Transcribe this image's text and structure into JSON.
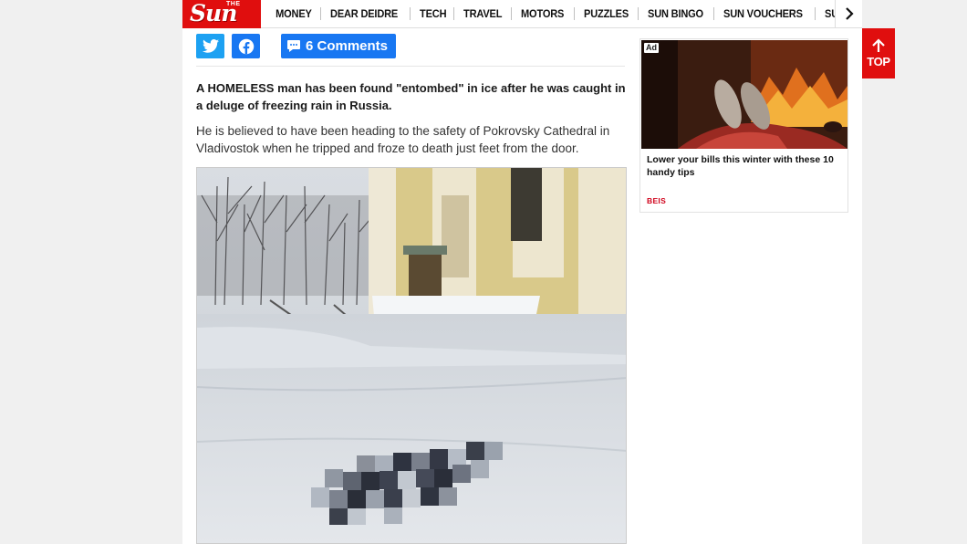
{
  "header": {
    "logo_small": "THE",
    "logo_main": "Sun",
    "nav_items": [
      "MONEY",
      "DEAR DEIDRE",
      "TECH",
      "TRAVEL",
      "MOTORS",
      "PUZZLES",
      "SUN BINGO",
      "SUN VOUCHERS",
      "SUN WIN"
    ]
  },
  "share": {
    "comments_label": "6 Comments"
  },
  "article": {
    "lead": "A HOMELESS man has been found \"entombed\" in ice after he was caught in a deluge of freezing rain in Russia.",
    "paragraph": "He is believed to have been heading to the safety of Pokrovsky Cathedral in Vladivostok when he tripped and froze to death just feet from the door."
  },
  "ad": {
    "badge": "Ad",
    "title": "Lower your bills this winter with these 10 handy tips",
    "source": "BEIS"
  },
  "top_button": {
    "label": "TOP"
  },
  "colors": {
    "brand_red": "#e00e0e",
    "twitter_blue": "#1da1f2",
    "facebook_blue": "#1877f2",
    "ad_source_red": "#d0021b"
  },
  "icons": [
    "twitter-icon",
    "facebook-icon",
    "comment-icon",
    "chevron-right-icon",
    "arrow-up-icon"
  ]
}
